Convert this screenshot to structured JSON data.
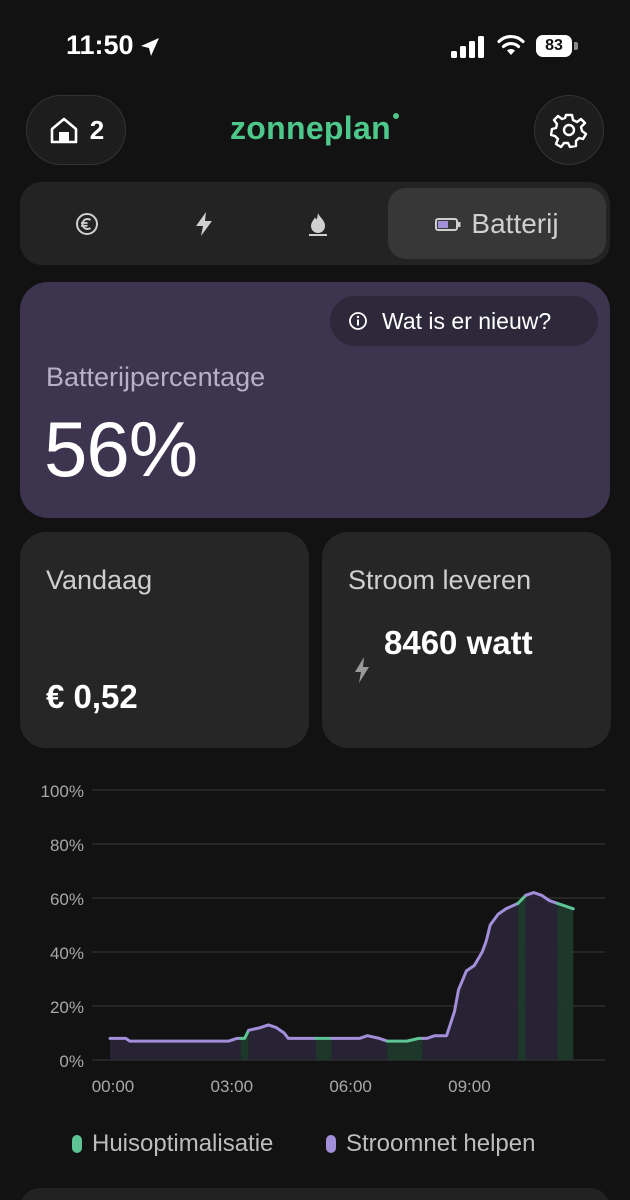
{
  "status_bar": {
    "time": "11:50",
    "battery_level": "83"
  },
  "header": {
    "home_count": "2",
    "brand": "zonneplan"
  },
  "tabs": [
    {
      "name": "euro",
      "icon": "euro-icon"
    },
    {
      "name": "power",
      "icon": "bolt-icon"
    },
    {
      "name": "gas",
      "icon": "flame-icon"
    },
    {
      "name": "battery",
      "icon": "battery-icon",
      "label": "Batterij",
      "active": true
    }
  ],
  "battery_card": {
    "news_label": "Wat is er nieuw?",
    "label": "Batterijpercentage",
    "value": "56%"
  },
  "today_card": {
    "title": "Vandaag",
    "value": "€ 0,52"
  },
  "power_card": {
    "title": "Stroom leveren",
    "value": "8460 watt"
  },
  "colors": {
    "brand_green": "#4ec78a",
    "card_purple": "#3d3450",
    "line_purple": "#a38ed9",
    "line_green": "#5ec495"
  },
  "chart_data": {
    "type": "line",
    "ylim": [
      0,
      100
    ],
    "y_ticks": [
      "0%",
      "20%",
      "40%",
      "60%",
      "80%",
      "100%"
    ],
    "x_ticks": [
      "00:00",
      "03:00",
      "06:00",
      "09:00"
    ],
    "x_tick_hours": [
      0,
      3,
      6,
      9
    ],
    "x_range_hours": [
      0,
      12.5
    ],
    "grid": true,
    "legend_position": "bottom",
    "series_names": [
      "Huisoptimalisatie",
      "Stroomnet helpen"
    ],
    "points": [
      [
        0.0,
        8
      ],
      [
        0.4,
        8
      ],
      [
        0.5,
        7
      ],
      [
        1.0,
        7
      ],
      [
        1.5,
        7
      ],
      [
        2.0,
        7
      ],
      [
        2.5,
        7
      ],
      [
        3.0,
        7
      ],
      [
        3.2,
        8
      ],
      [
        3.4,
        8
      ],
      [
        3.5,
        11
      ],
      [
        3.8,
        12
      ],
      [
        4.0,
        13
      ],
      [
        4.2,
        12
      ],
      [
        4.4,
        10
      ],
      [
        4.5,
        8
      ],
      [
        5.0,
        8
      ],
      [
        5.5,
        8
      ],
      [
        6.0,
        8
      ],
      [
        6.3,
        8
      ],
      [
        6.5,
        9
      ],
      [
        6.8,
        8
      ],
      [
        7.0,
        7
      ],
      [
        7.5,
        7
      ],
      [
        7.8,
        8
      ],
      [
        8.0,
        8
      ],
      [
        8.2,
        9
      ],
      [
        8.5,
        9
      ],
      [
        8.7,
        18
      ],
      [
        8.8,
        26
      ],
      [
        9.0,
        33
      ],
      [
        9.2,
        35
      ],
      [
        9.4,
        40
      ],
      [
        9.5,
        44
      ],
      [
        9.6,
        50
      ],
      [
        9.8,
        54
      ],
      [
        10.0,
        56
      ],
      [
        10.3,
        58
      ],
      [
        10.5,
        61
      ],
      [
        10.7,
        62
      ],
      [
        10.9,
        61
      ],
      [
        11.1,
        59
      ],
      [
        11.3,
        58
      ],
      [
        11.5,
        57
      ],
      [
        11.7,
        56
      ]
    ],
    "mode_segments": [
      {
        "mode": "Stroomnet helpen",
        "from": 0.0,
        "to": 3.3
      },
      {
        "mode": "Huisoptimalisatie",
        "from": 3.3,
        "to": 3.5
      },
      {
        "mode": "Stroomnet helpen",
        "from": 3.5,
        "to": 5.2
      },
      {
        "mode": "Huisoptimalisatie",
        "from": 5.2,
        "to": 5.6
      },
      {
        "mode": "Stroomnet helpen",
        "from": 5.6,
        "to": 7.0
      },
      {
        "mode": "Huisoptimalisatie",
        "from": 7.0,
        "to": 7.9
      },
      {
        "mode": "Stroomnet helpen",
        "from": 7.9,
        "to": 10.3
      },
      {
        "mode": "Huisoptimalisatie",
        "from": 10.3,
        "to": 10.5
      },
      {
        "mode": "Stroomnet helpen",
        "from": 10.5,
        "to": 11.3
      },
      {
        "mode": "Huisoptimalisatie",
        "from": 11.3,
        "to": 11.7
      }
    ]
  }
}
